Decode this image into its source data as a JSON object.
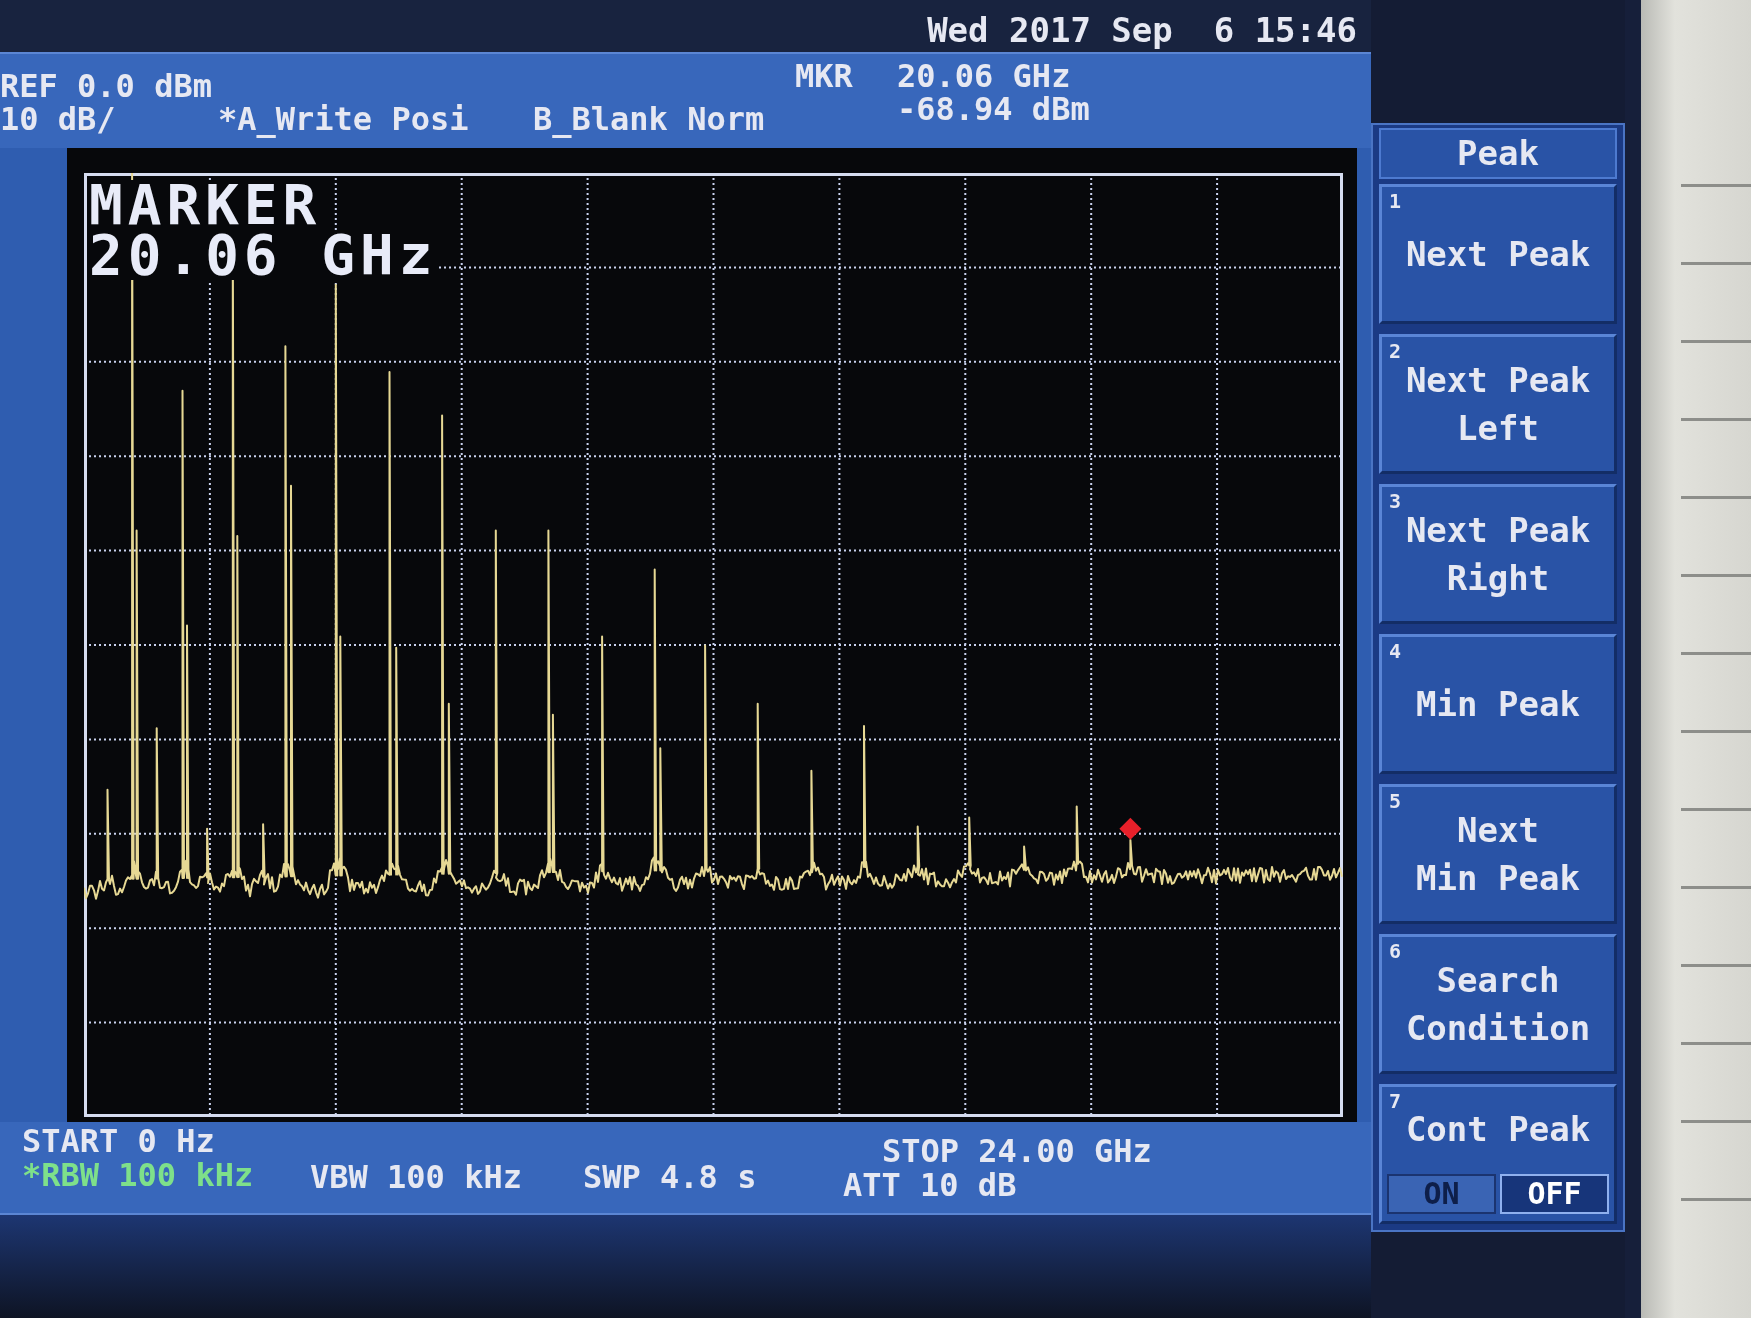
{
  "top_bar": {
    "datetime": "Wed 2017 Sep  6 15:46"
  },
  "header": {
    "reference_level": "REF 0.0 dBm",
    "scale": "10 dB/",
    "traces": [
      "*A_Write Posi",
      "B_Blank Norm"
    ],
    "marker": {
      "label": "MKR",
      "frequency": "20.06 GHz",
      "amplitude": "-68.94 dBm"
    }
  },
  "graph": {
    "marker_title": "MARKER",
    "marker_frequency": "20.06 GHz"
  },
  "settings": [
    {
      "text": "START 0 Hz",
      "highlighted": false
    },
    {
      "text": "STOP 24.00 GHz",
      "highlighted": false
    },
    {
      "text": "*RBW 100 kHz",
      "highlighted": true
    },
    {
      "text": "VBW 100 kHz",
      "highlighted": false
    },
    {
      "text": "SWP 4.8 s",
      "highlighted": false
    },
    {
      "text": "ATT 10 dB",
      "highlighted": false
    }
  ],
  "menu": {
    "title": "Peak",
    "softkeys": [
      {
        "kind": "action",
        "number": "1",
        "lines": [
          "Next Peak"
        ]
      },
      {
        "kind": "action",
        "number": "2",
        "lines": [
          "Next Peak",
          "Left"
        ]
      },
      {
        "kind": "action",
        "number": "3",
        "lines": [
          "Next Peak",
          "Right"
        ]
      },
      {
        "kind": "action",
        "number": "4",
        "lines": [
          "Min Peak"
        ]
      },
      {
        "kind": "action",
        "number": "5",
        "lines": [
          "Next",
          "Min Peak"
        ]
      },
      {
        "kind": "action",
        "number": "6",
        "lines": [
          "Search",
          "Condition"
        ]
      },
      {
        "kind": "toggle",
        "number": "7",
        "lines": [
          "Cont Peak"
        ],
        "options": [
          {
            "label": "ON",
            "selected": false
          },
          {
            "label": "OFF",
            "selected": true
          }
        ]
      }
    ]
  }
}
